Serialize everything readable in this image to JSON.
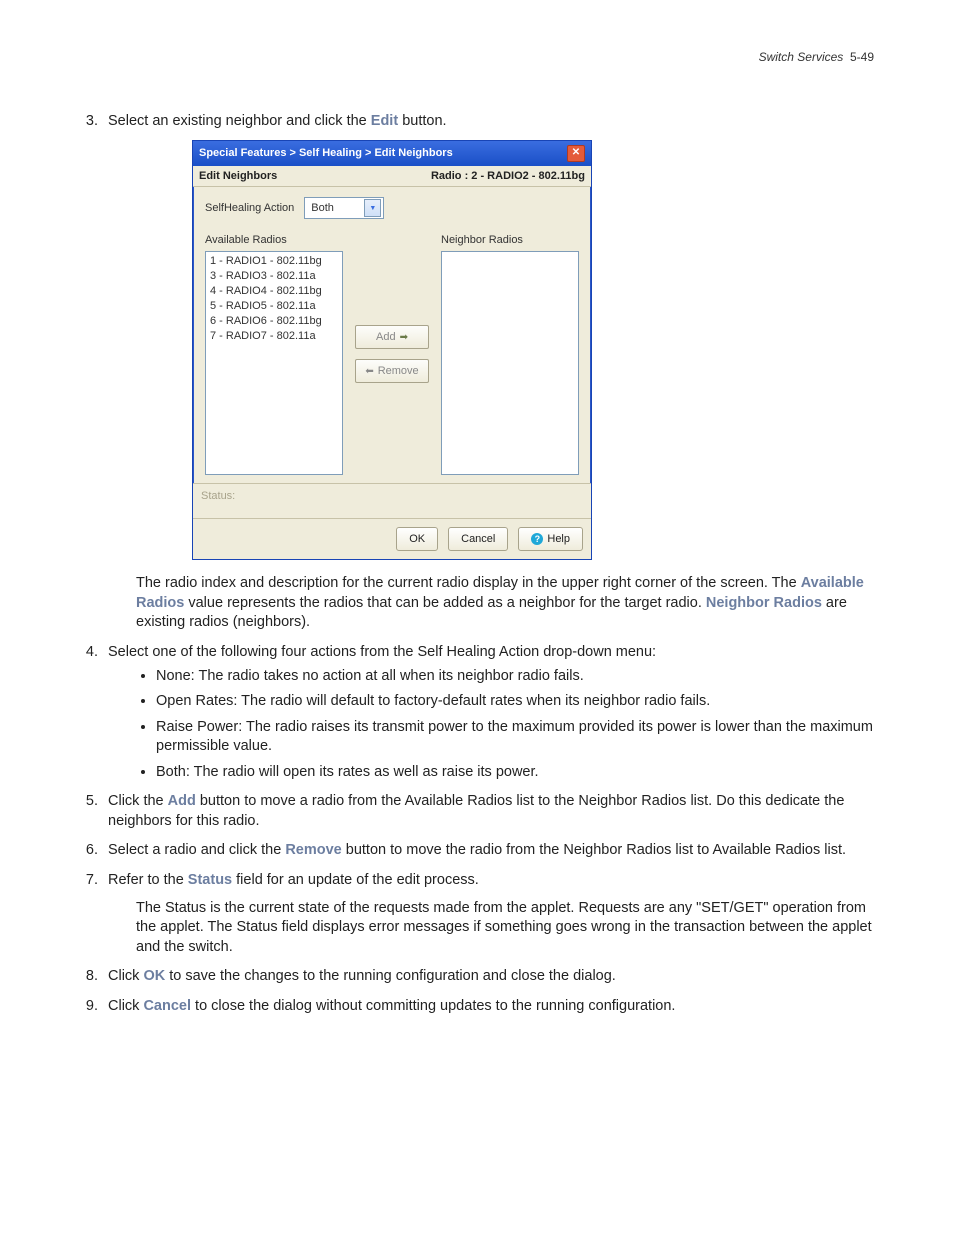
{
  "header": {
    "section": "Switch Services",
    "page": "5-49"
  },
  "step3": {
    "prefix": "Select an existing neighbor and click the ",
    "bold": "Edit",
    "suffix": " button."
  },
  "dialog": {
    "breadcrumb": "Special Features > Self Healing > Edit Neighbors",
    "sub_left": "Edit Neighbors",
    "sub_right": "Radio : 2 - RADIO2 - 802.11bg",
    "action_label": "SelfHealing Action",
    "action_value": "Both",
    "available_label": "Available Radios",
    "neighbor_label": "Neighbor Radios",
    "available_items": [
      "1 - RADIO1 - 802.11bg",
      "3 - RADIO3 - 802.11a",
      "4 - RADIO4 - 802.11bg",
      "5 - RADIO5 - 802.11a",
      "6 - RADIO6 - 802.11bg",
      "7 - RADIO7 - 802.11a"
    ],
    "add_label": "Add",
    "remove_label": "Remove",
    "status_label": "Status:",
    "ok": "OK",
    "cancel": "Cancel",
    "help": "Help"
  },
  "para1": {
    "t1": "The radio index and description for the current radio display in the upper right corner of the screen. The ",
    "b1": "Available Radios",
    "t2": " value represents the radios that can be added as a neighbor for the target radio. ",
    "b2": "Neighbor Radios",
    "t3": " are existing radios (neighbors)."
  },
  "step4": "Select one of the following four actions from the Self Healing Action drop-down menu:",
  "bullets": [
    "None: The radio takes no action at all when its neighbor radio fails.",
    "Open Rates: The radio will default to factory-default rates when its neighbor radio fails.",
    "Raise Power: The radio raises its transmit power to the maximum provided its power is lower than the maximum permissible value.",
    "Both: The radio will open its rates as well as raise its power."
  ],
  "step5": {
    "t1": "Click the ",
    "b1": "Add",
    "t2": " button to move a radio from the Available Radios list to the Neighbor Radios list. Do this dedicate the neighbors for this radio."
  },
  "step6": {
    "t1": "Select a radio and click the ",
    "b1": "Remove",
    "t2": " button to move the radio from the Neighbor Radios list to Available Radios list."
  },
  "step7": {
    "t1": "Refer to the ",
    "b1": "Status",
    "t2": " field for an update of the edit process."
  },
  "para2": "The Status is the current state of the requests made from the applet. Requests are any \"SET/GET\" operation from the applet. The Status field displays error messages if something goes wrong in the transaction between the applet and the switch.",
  "step8": {
    "t1": "Click ",
    "b1": "OK",
    "t2": " to save the changes to the running configuration and close the dialog."
  },
  "step9": {
    "t1": "Click ",
    "b1": "Cancel",
    "t2": " to close the dialog without committing updates to the running configuration."
  }
}
